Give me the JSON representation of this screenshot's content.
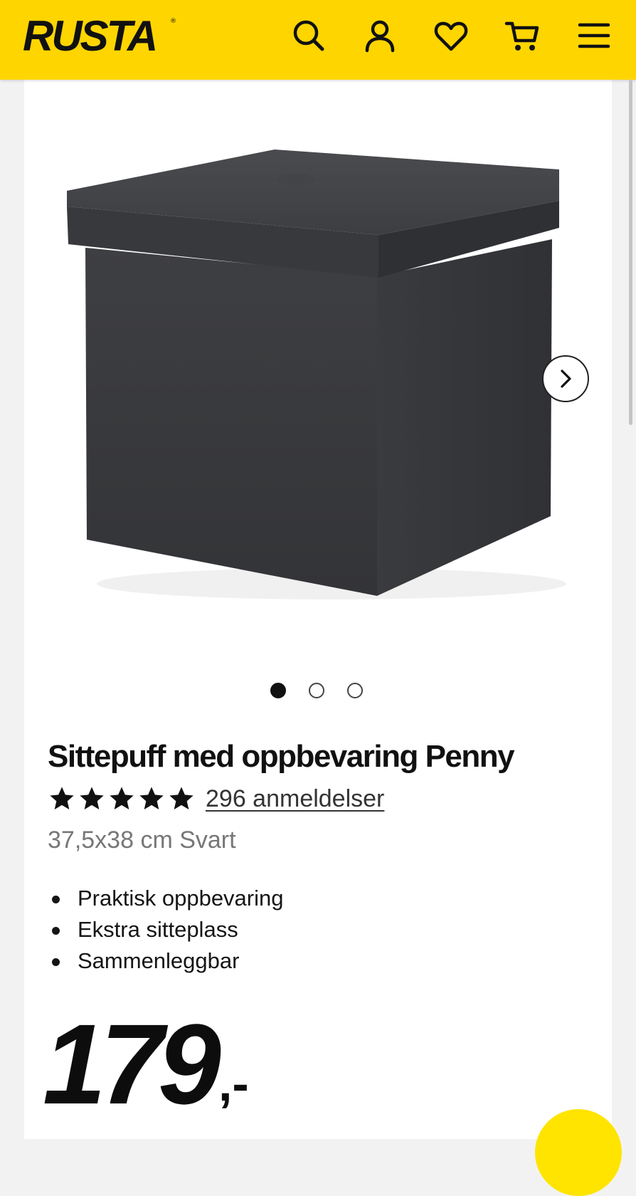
{
  "header": {
    "logo_text": "RUSTA",
    "logo_mark": "®",
    "background_color": "#ffd500",
    "icons": [
      "search-icon",
      "user-icon",
      "heart-icon",
      "cart-icon",
      "menu-icon"
    ]
  },
  "gallery": {
    "image": "grey-storage-ottoman",
    "slide_count": 3,
    "active_slide": 1,
    "next_icon": "chevron-right-icon"
  },
  "product": {
    "title": "Sittepuff med oppbevaring Penny",
    "rating_stars": 5,
    "reviews_label": "296 anmeldelser",
    "variant": "37,5x38 cm Svart",
    "features": [
      "Praktisk oppbevaring",
      "Ekstra sitteplass",
      "Sammenleggbar"
    ],
    "price": "179",
    "price_suffix": ",-"
  },
  "colors": {
    "accent": "#ffd500",
    "fab": "#ffe400",
    "text": "#151515",
    "muted": "#777777"
  }
}
